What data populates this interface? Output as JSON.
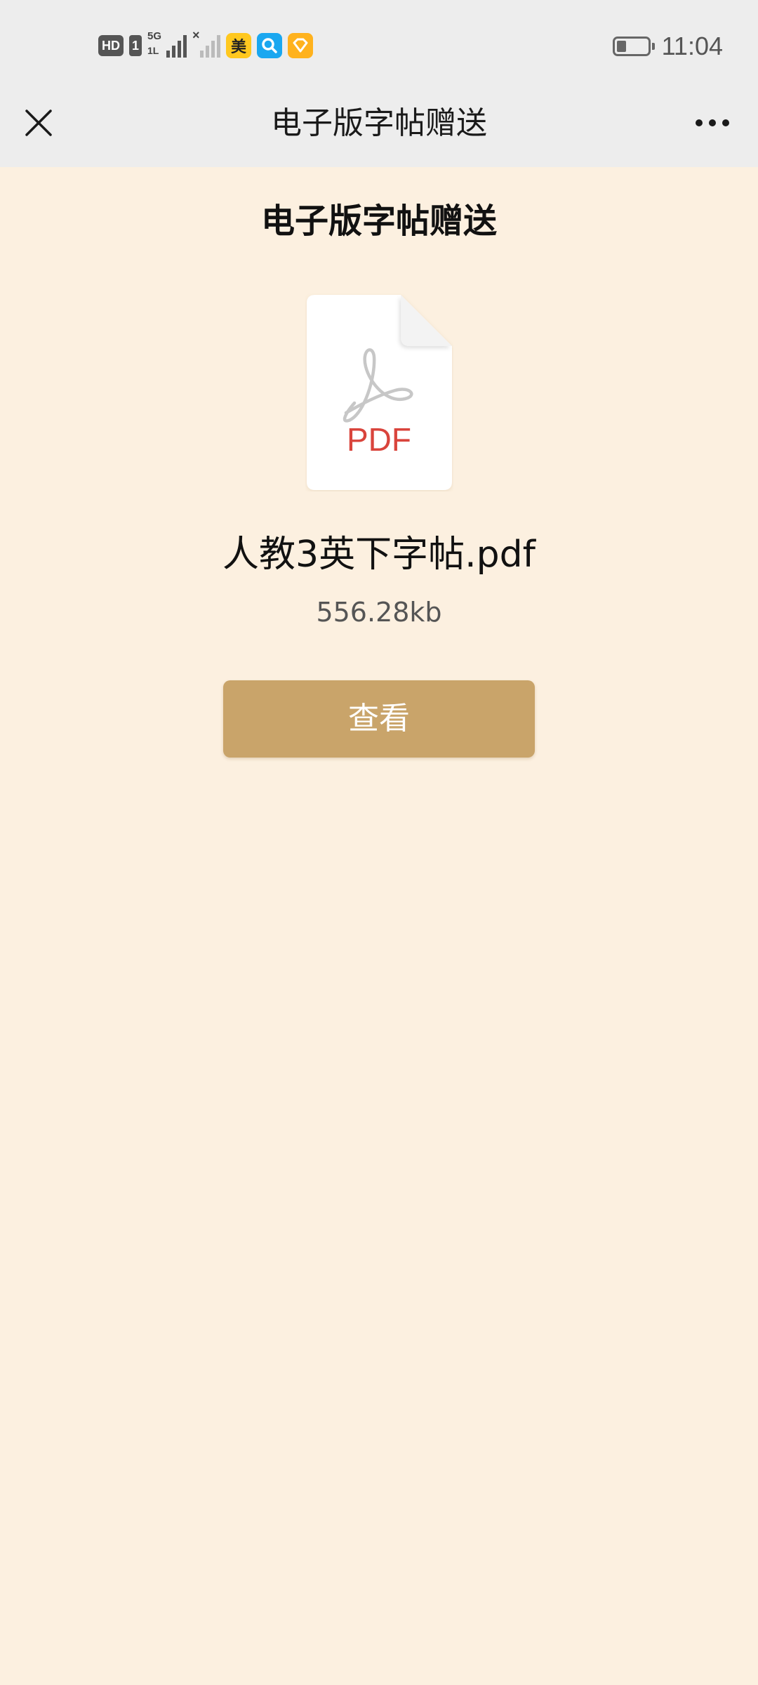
{
  "status_bar": {
    "hd_label": "HD",
    "sim_label": "1",
    "network_label": "5G",
    "network_sub": "1L",
    "app_badge_mei": "美",
    "battery_level": 0.3,
    "time": "11:04"
  },
  "nav": {
    "title": "电子版字帖赠送",
    "close_icon": "close-icon",
    "more_icon": "more-icon"
  },
  "content": {
    "heading": "电子版字帖赠送",
    "file_icon_label": "PDF",
    "file_name": "人教3英下字帖.pdf",
    "file_size": "556.28kb",
    "view_button_label": "查看"
  },
  "colors": {
    "page_background": "#fcf0e0",
    "header_background": "#ededed",
    "button": "#c9a46a",
    "pdf_red": "#d9443c"
  }
}
